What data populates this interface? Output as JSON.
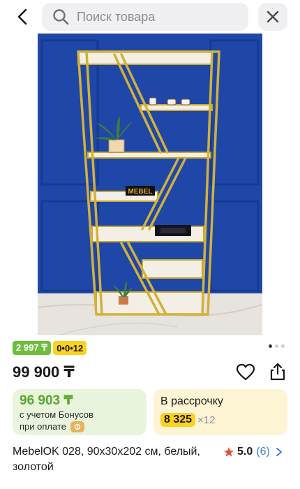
{
  "search": {
    "placeholder": "Поиск товара"
  },
  "badges": {
    "bonus": "2 997 ₸",
    "installment_plan": "0•0•12"
  },
  "gallery": {
    "total_images": 3,
    "active_index": 0
  },
  "product": {
    "price": "99 900 ₸",
    "title": "MebelOK 028, 90x30x202 см, белый, золотой",
    "brand_sign": "MEBEL"
  },
  "bonus_card": {
    "price": "96 903 ₸",
    "note_line1": "с учетом Бонусов",
    "note_line2": "при оплате"
  },
  "installment_card": {
    "title": "В рассрочку",
    "amount": "8 325",
    "multiplier": "×12"
  },
  "rating": {
    "score": "5.0",
    "count": "(6)"
  },
  "colors": {
    "accent_green": "#6ebe3c",
    "accent_yellow": "#fcd11f",
    "link_blue": "#3a7fd5",
    "star_red": "#e74c3c"
  }
}
